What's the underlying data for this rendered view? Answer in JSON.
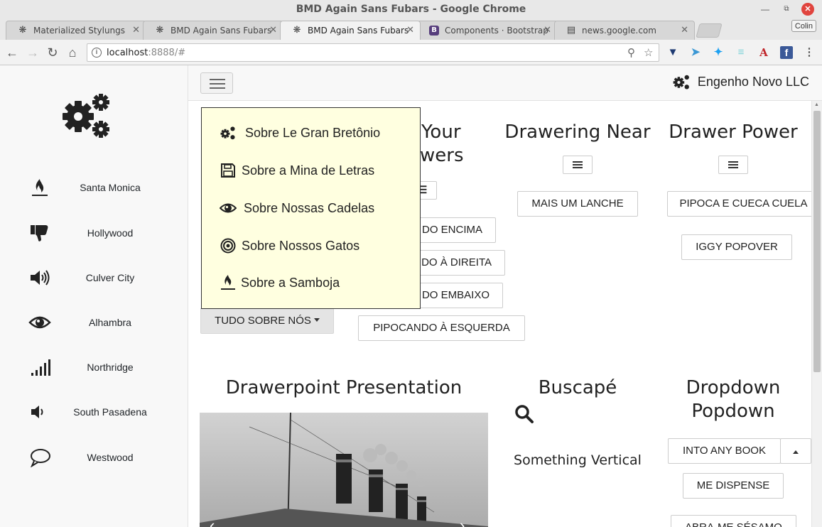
{
  "window": {
    "title": "BMD Again Sans Fubars - Google Chrome",
    "profile": "Colin"
  },
  "tabs": [
    {
      "label": "Materialized Stylungs",
      "favicon": "gear-icon",
      "active": false
    },
    {
      "label": "BMD Again Sans Fubars",
      "favicon": "gear-icon",
      "active": false
    },
    {
      "label": "BMD Again Sans Fubars",
      "favicon": "gear-icon",
      "active": true
    },
    {
      "label": "Components · Bootstrap",
      "favicon": "bootstrap-icon",
      "favicon_text": "B",
      "active": false
    },
    {
      "label": "news.google.com",
      "favicon": "page-icon",
      "active": false
    }
  ],
  "address_bar": {
    "host": "localhost",
    "rest": ":8888/#"
  },
  "sidebar": {
    "items": [
      {
        "label": "Santa Monica",
        "icon": "fire-icon"
      },
      {
        "label": "Hollywood",
        "icon": "thumbs-down-icon"
      },
      {
        "label": "Culver City",
        "icon": "volume-up-icon"
      },
      {
        "label": "Alhambra",
        "icon": "eye-icon"
      },
      {
        "label": "Northridge",
        "icon": "signal-icon"
      },
      {
        "label": "South Pasadena",
        "icon": "volume-down-icon"
      },
      {
        "label": "Westwood",
        "icon": "comment-icon"
      }
    ]
  },
  "navbar": {
    "brand": "Engenho Novo LLC"
  },
  "dropdown_menu": {
    "items": [
      {
        "label": "Sobre Le Gran Bretônio",
        "icon": "gears-icon"
      },
      {
        "label": "Sobre a Mina de Letras",
        "icon": "floppy-disk-icon"
      },
      {
        "label": "Sobre Nossas Cadelas",
        "icon": "eye-icon"
      },
      {
        "label": "Sobre Nossos Gatos",
        "icon": "bullseye-icon"
      },
      {
        "label": "Sobre a Samboja",
        "icon": "fire-icon"
      }
    ],
    "toggle_label": "TUDO SOBRE NÓS"
  },
  "sections": {
    "your_drawers": {
      "title_line1": "Your",
      "title_line2": "wers",
      "buttons": [
        "DO ENCIMA",
        "DO À DIREITA",
        "DO EMBAIXO",
        "PIPOCANDO À ESQUERDA"
      ]
    },
    "drawering_near": {
      "title": "Drawering Near",
      "button": "MAIS UM LANCHE"
    },
    "drawer_power": {
      "title": "Drawer Power",
      "buttons": [
        "PIPOCA E CUECA CUELA",
        "IGGY POPOVER"
      ]
    },
    "drawerpoint": {
      "title": "Drawerpoint Presentation"
    },
    "buscape": {
      "title": "Buscapé",
      "vertical_text": "Something Vertical"
    },
    "dropdown_popdown": {
      "title_line1": "Dropdown",
      "title_line2": "Popdown",
      "split_button": "INTO ANY BOOK",
      "buttons": [
        "ME DISPENSE",
        "ABRA-ME SÉSAMO"
      ]
    }
  }
}
